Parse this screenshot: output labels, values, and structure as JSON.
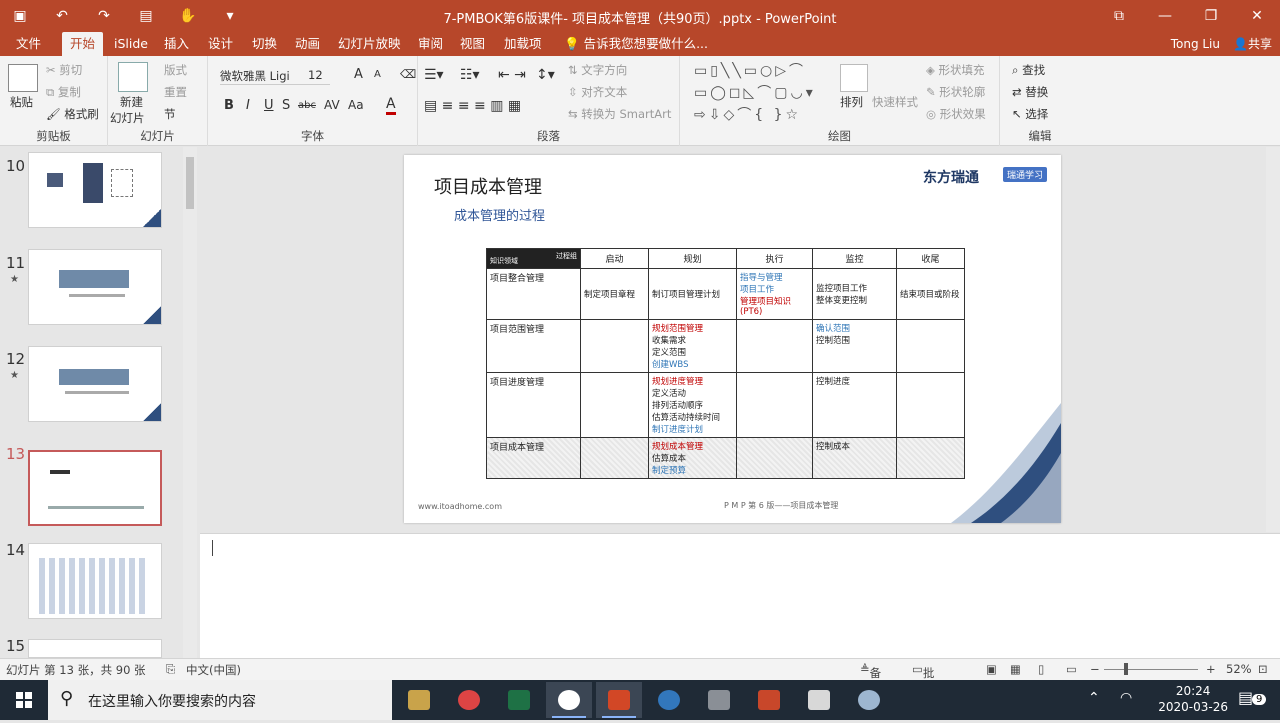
{
  "window": {
    "title": "7-PMBOK第6版课件- 项目成本管理（共90页）.pptx - PowerPoint",
    "controls": [
      "⧉",
      "—",
      "❐",
      "✕"
    ]
  },
  "tabs": [
    {
      "label": "文件"
    },
    {
      "label": "开始"
    },
    {
      "label": "iSlide"
    },
    {
      "label": "插入"
    },
    {
      "label": "设计"
    },
    {
      "label": "切换"
    },
    {
      "label": "动画"
    },
    {
      "label": "幻灯片放映"
    },
    {
      "label": "审阅"
    },
    {
      "label": "视图"
    },
    {
      "label": "加载项"
    },
    {
      "label": "告诉我您想要做什么..."
    }
  ],
  "user": "Tong Liu",
  "share": "共享",
  "ribbon": {
    "clipboard": {
      "label": "剪贴板",
      "paste": "粘贴",
      "cut": "剪切",
      "copy": "复制",
      "painter": "格式刷"
    },
    "slides": {
      "label": "幻灯片",
      "new_slide_1": "新建",
      "new_slide_2": "幻灯片",
      "layout": "版式",
      "reset": "重置",
      "section": "节"
    },
    "font": {
      "label": "字体",
      "font_name": "微软雅黑 Ligi",
      "font_size": "12",
      "bold": "B",
      "italic": "I",
      "underline": "U",
      "strike": "S",
      "shadow": "abc",
      "spacing": "AV",
      "case": "Aa",
      "color": "A",
      "grow": "A",
      "shrink": "A"
    },
    "paragraph": {
      "label": "段落",
      "text_direction": "文字方向",
      "align_text": "对齐文本",
      "smartart": "转换为 SmartArt"
    },
    "drawing": {
      "label": "绘图",
      "arrange": "排列",
      "quick_styles": "快速样式",
      "fill": "形状填充",
      "outline": "形状轮廓",
      "effects": "形状效果"
    },
    "editing": {
      "label": "编辑",
      "find": "查找",
      "replace": "替换",
      "select": "选择"
    }
  },
  "thumbnails": [
    {
      "num": "10",
      "star": ""
    },
    {
      "num": "11",
      "star": "★"
    },
    {
      "num": "12",
      "star": "★"
    },
    {
      "num": "13",
      "star": ""
    },
    {
      "num": "14",
      "star": ""
    },
    {
      "num": "15",
      "star": ""
    }
  ],
  "slide": {
    "title": "项目成本管理",
    "subtitle": "成本管理的过程",
    "brand": "东方瑞通",
    "brand_tag": "瑞通学习",
    "footer_left": "www.itoadhome.com",
    "footer_center": "P M P 第 6 版——项目成本管理",
    "table": {
      "corner_top": "过程组",
      "corner_bottom": "知识领域",
      "headers": [
        "启动",
        "规划",
        "执行",
        "监控",
        "收尾"
      ],
      "rows": [
        {
          "area": "项目整合管理",
          "cells": [
            {
              "lines": [
                {
                  "t": "制定项目章程",
                  "c": ""
                }
              ]
            },
            {
              "lines": [
                {
                  "t": "制订项目管理计划",
                  "c": ""
                }
              ]
            },
            {
              "lines": [
                {
                  "t": "指导与管理",
                  "c": "blue"
                },
                {
                  "t": "项目工作",
                  "c": "blue"
                },
                {
                  "t": "管理项目知识",
                  "c": "red"
                },
                {
                  "t": "(PT6)",
                  "c": "red"
                }
              ]
            },
            {
              "lines": [
                {
                  "t": "监控项目工作",
                  "c": ""
                },
                {
                  "t": "整体变更控制",
                  "c": ""
                }
              ]
            },
            {
              "lines": [
                {
                  "t": "结束项目或阶段",
                  "c": ""
                }
              ]
            }
          ]
        },
        {
          "area": "项目范围管理",
          "cells": [
            {
              "lines": []
            },
            {
              "lines": [
                {
                  "t": "规划范围管理",
                  "c": "red"
                },
                {
                  "t": "收集需求",
                  "c": ""
                },
                {
                  "t": "定义范围",
                  "c": ""
                },
                {
                  "t": "创建WBS",
                  "c": "blue"
                }
              ]
            },
            {
              "lines": []
            },
            {
              "lines": [
                {
                  "t": "确认范围",
                  "c": "blue"
                },
                {
                  "t": "控制范围",
                  "c": ""
                }
              ]
            },
            {
              "lines": []
            }
          ]
        },
        {
          "area": "项目进度管理",
          "cells": [
            {
              "lines": []
            },
            {
              "lines": [
                {
                  "t": "规划进度管理",
                  "c": "red"
                },
                {
                  "t": "定义活动",
                  "c": ""
                },
                {
                  "t": "排列活动顺序",
                  "c": ""
                },
                {
                  "t": "估算活动持续时间",
                  "c": ""
                },
                {
                  "t": "制订进度计划",
                  "c": "blue"
                }
              ]
            },
            {
              "lines": []
            },
            {
              "lines": [
                {
                  "t": "控制进度",
                  "c": ""
                }
              ]
            },
            {
              "lines": []
            }
          ]
        },
        {
          "area": "项目成本管理",
          "cells": [
            {
              "lines": []
            },
            {
              "lines": [
                {
                  "t": "规划成本管理",
                  "c": "red"
                },
                {
                  "t": "估算成本",
                  "c": ""
                },
                {
                  "t": "制定预算",
                  "c": "blue"
                }
              ]
            },
            {
              "lines": []
            },
            {
              "lines": [
                {
                  "t": "控制成本",
                  "c": ""
                }
              ]
            },
            {
              "lines": []
            }
          ]
        }
      ]
    }
  },
  "status": {
    "slide_info": "幻灯片 第 13 张，共 90 张",
    "language": "中文(中国)",
    "notes": "备注",
    "comments": "批注",
    "zoom": "52%"
  },
  "taskbar": {
    "search_placeholder": "在这里输入你要搜索的内容",
    "time": "20:24",
    "date": "2020-03-26",
    "notif_count": "9"
  }
}
